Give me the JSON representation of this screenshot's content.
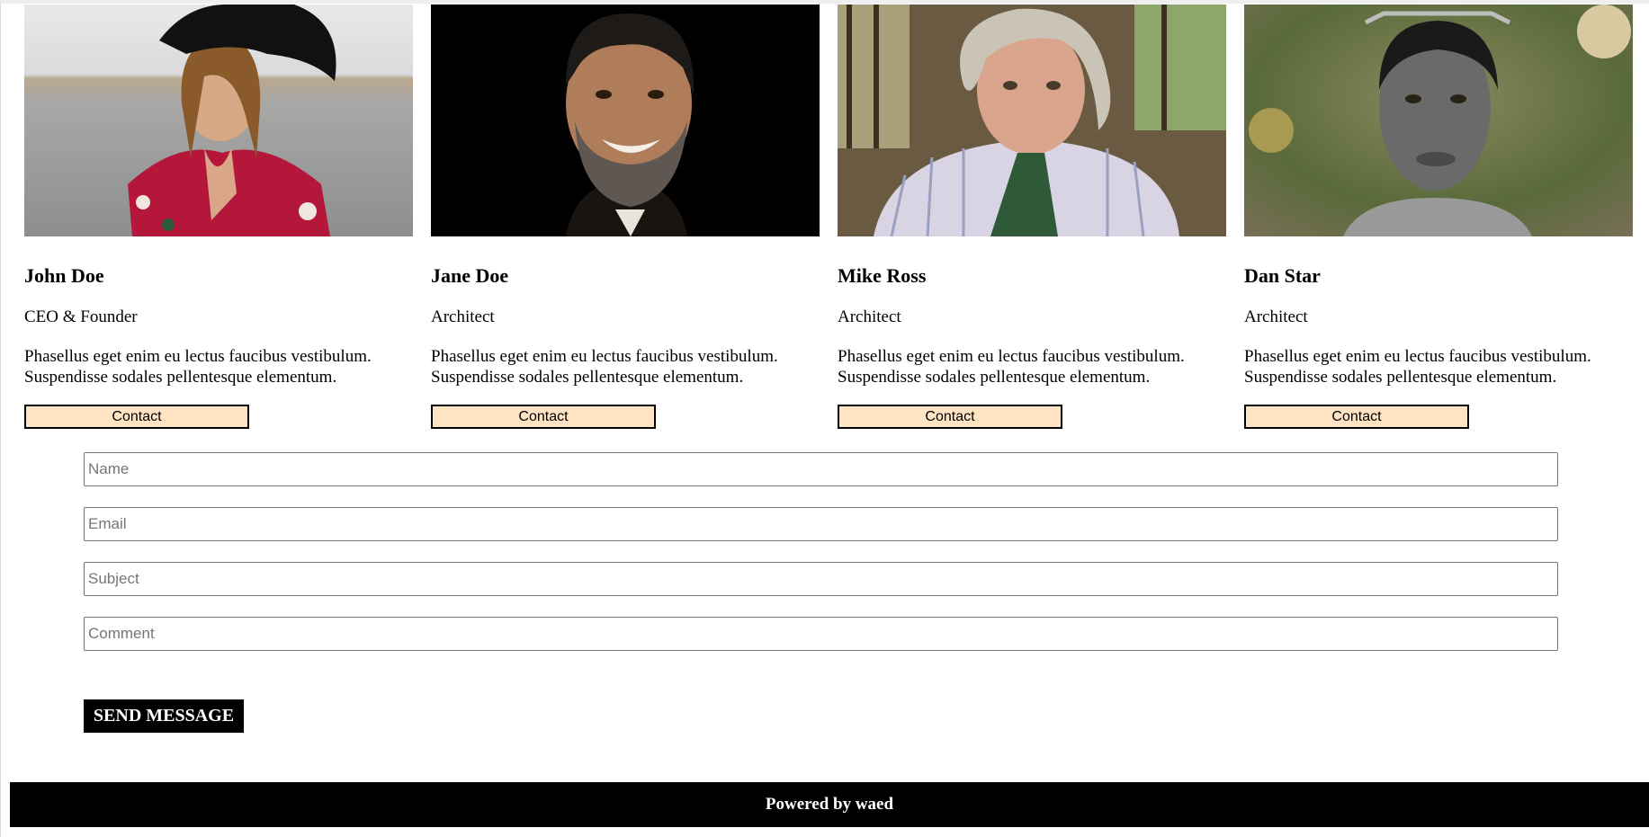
{
  "team": [
    {
      "name": "John Doe",
      "title": "CEO & Founder",
      "description_line1": "Phasellus eget enim eu lectus faucibus vestibulum.",
      "description_line2": "Suspendisse sodales pellentesque elementum.",
      "contact_label": "Contact"
    },
    {
      "name": "Jane Doe",
      "title": "Architect",
      "description_line1": "Phasellus eget enim eu lectus faucibus vestibulum.",
      "description_line2": "Suspendisse sodales pellentesque elementum.",
      "contact_label": "Contact"
    },
    {
      "name": "Mike Ross",
      "title": "Architect",
      "description_line1": "Phasellus eget enim eu lectus faucibus vestibulum.",
      "description_line2": "Suspendisse sodales pellentesque elementum.",
      "contact_label": "Contact"
    },
    {
      "name": "Dan Star",
      "title": "Architect",
      "description_line1": "Phasellus eget enim eu lectus faucibus vestibulum.",
      "description_line2": "Suspendisse sodales pellentesque elementum.",
      "contact_label": "Contact"
    }
  ],
  "form": {
    "name_placeholder": "Name",
    "email_placeholder": "Email",
    "subject_placeholder": "Subject",
    "comment_placeholder": "Comment",
    "name_value": "",
    "email_value": "",
    "subject_value": "",
    "comment_value": "",
    "send_label": "SEND MESSAGE"
  },
  "footer": {
    "text": "Powered by waed"
  },
  "colors": {
    "contact_button_bg": "#ffe4c4",
    "send_button_bg": "#000000",
    "footer_bg": "#000000"
  }
}
